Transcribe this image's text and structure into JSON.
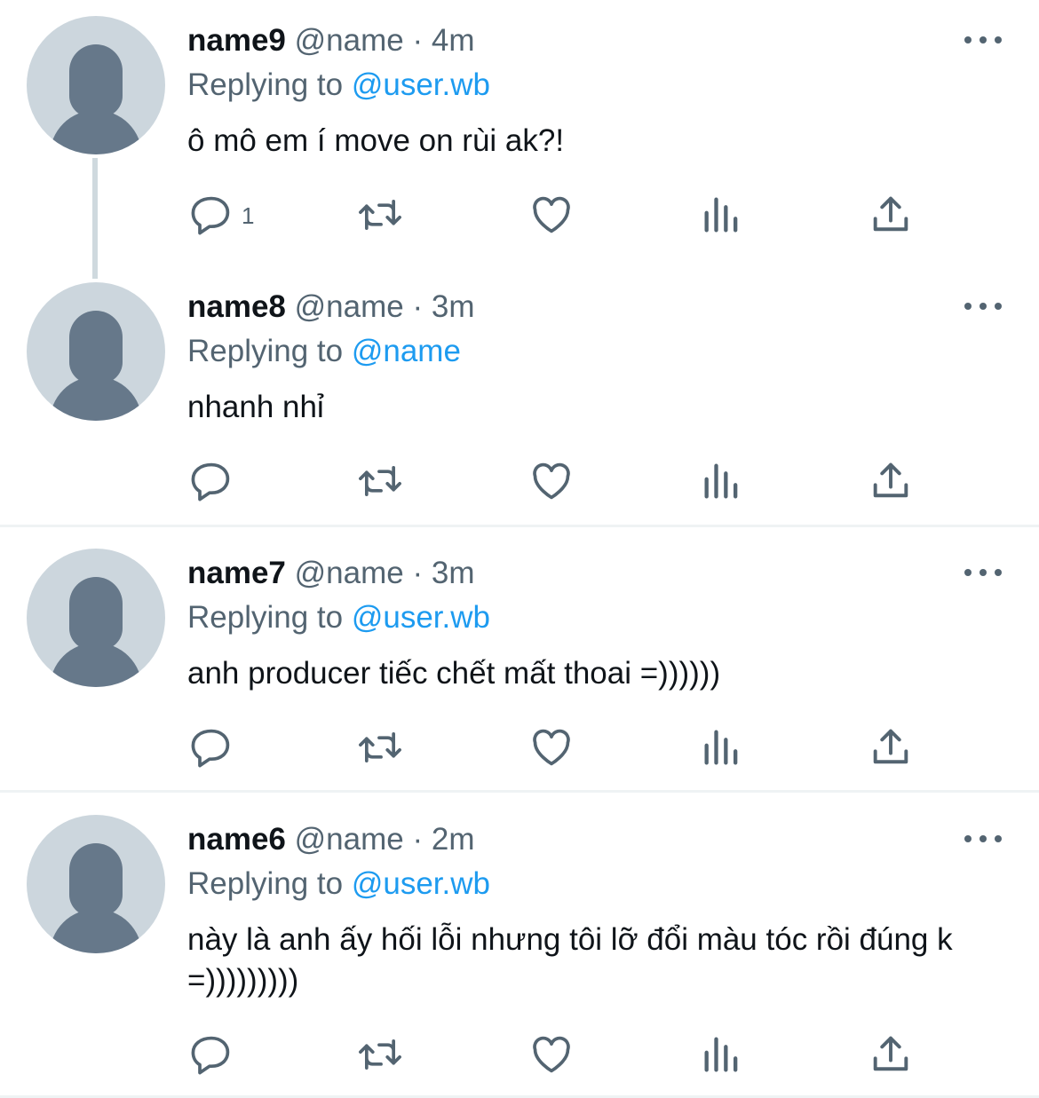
{
  "tweets": [
    {
      "name": "name9",
      "handle": "@name",
      "sep": "·",
      "time": "4m",
      "replying_prefix": "Replying to",
      "replying_to": "@user.wb",
      "text": "ô mô em í move on rùi ak?!",
      "reply_count": "1"
    },
    {
      "name": "name8",
      "handle": "@name",
      "sep": "·",
      "time": "3m",
      "replying_prefix": "Replying to",
      "replying_to": "@name",
      "text": "nhanh nhỉ"
    },
    {
      "name": "name7",
      "handle": "@name",
      "sep": "·",
      "time": "3m",
      "replying_prefix": "Replying to",
      "replying_to": "@user.wb",
      "text": "anh producer tiếc chết mất thoai =))))))"
    },
    {
      "name": "name6",
      "handle": "@name",
      "sep": "·",
      "time": "2m",
      "replying_prefix": "Replying to",
      "replying_to": "@user.wb",
      "text": "này là anh ấy hối lỗi nhưng tôi lỡ đổi màu tóc rồi đúng k =)))))))))"
    }
  ],
  "colors": {
    "link": "#1d9bf0",
    "muted": "#536471",
    "avatar_bg": "#ccd6dd",
    "avatar_fg": "#66788a",
    "divider": "#eff3f4"
  },
  "icons": [
    "reply-icon",
    "retweet-icon",
    "like-icon",
    "views-icon",
    "share-icon",
    "more-icon"
  ]
}
